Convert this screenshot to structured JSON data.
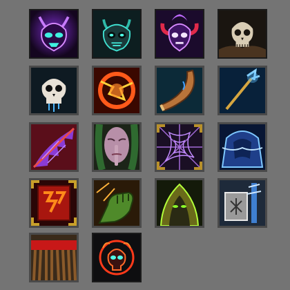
{
  "icons": [
    "purple-demon-skull-icon",
    "teal-demon-skull-icon",
    "horned-purple-flame-skull-icon",
    "skull-on-rubble-icon",
    "dripping-skull-icon",
    "fire-lightning-orb-icon",
    "wooden-horn-icon",
    "blue-glowing-trident-icon",
    "shredded-purple-wing-icon",
    "silence-finger-lips-icon",
    "purple-spider-web-icon",
    "blue-armored-cloak-icon",
    "red-war-banner-icon",
    "green-orc-fist-icon",
    "hooded-green-eyes-figure-icon",
    "frost-hammer-rune-icon",
    "red-bound-broom-icon",
    "fire-ring-skull-icon"
  ],
  "colors": {
    "background": "#747474",
    "purple_glow": "#b04bff",
    "teal_glow": "#3fe0d0",
    "fire": "#ff5a1a",
    "frost": "#7ec8ff",
    "fel_green": "#8cff2a"
  }
}
